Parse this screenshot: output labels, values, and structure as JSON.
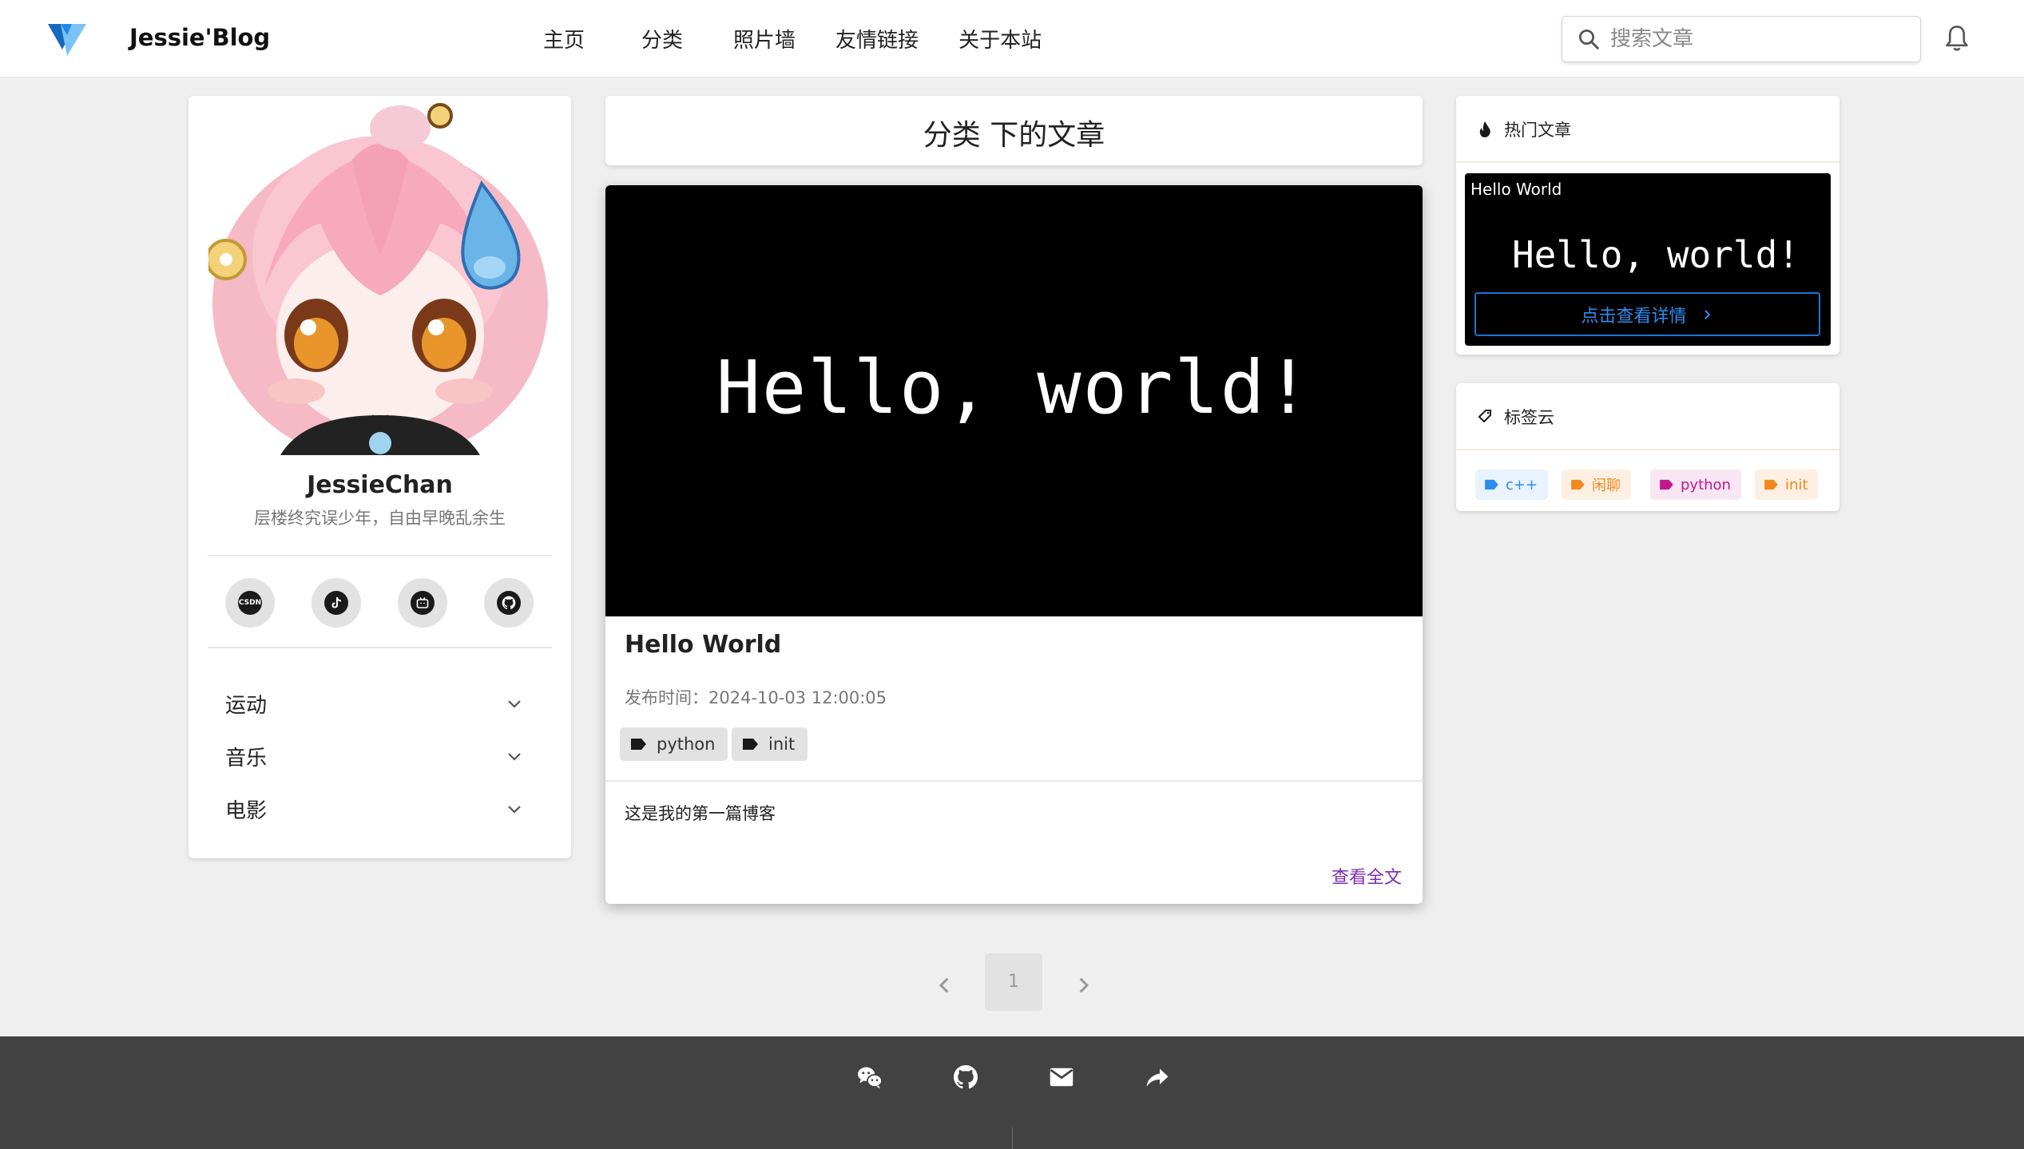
{
  "header": {
    "brand": "Jessie'Blog",
    "nav": [
      "主页",
      "分类",
      "照片墙",
      "友情链接",
      "关于本站"
    ],
    "search_placeholder": "搜索文章",
    "accent": "#2196f3"
  },
  "profile": {
    "name": "JessieChan",
    "motto": "层楼终究误少年，自由早晚乱余生",
    "social": [
      {
        "icon": "csdn-icon",
        "text": "CSDN"
      },
      {
        "icon": "tiktok-icon"
      },
      {
        "icon": "bilibili-icon"
      },
      {
        "icon": "github-icon"
      }
    ],
    "menu": [
      "运动",
      "音乐",
      "电影"
    ]
  },
  "main": {
    "page_title": "分类 下的文章",
    "posts": [
      {
        "cover_text": "Hello, world!",
        "title": "Hello World",
        "date": "发布时间：2024-10-03 12:00:05",
        "tags": [
          "python",
          "init"
        ],
        "excerpt": "这是我的第一篇博客",
        "read_more": "查看全文"
      }
    ],
    "pagination": {
      "current": "1"
    }
  },
  "sidebar": {
    "hot": {
      "title": "热门文章",
      "items": [
        {
          "title": "Hello World",
          "cover_text": "Hello, world!",
          "button": "点击查看详情"
        }
      ]
    },
    "tag_cloud": {
      "title": "标签云",
      "tags": [
        {
          "label": "c++",
          "color": "#2f8bf0",
          "bg": "#e8f3fd"
        },
        {
          "label": "闲聊",
          "color": "#f08a1c",
          "bg": "#fdf0e3"
        },
        {
          "label": "python",
          "color": "#c2188d",
          "bg": "#f8e6f2"
        },
        {
          "label": "init",
          "color": "#f08a1c",
          "bg": "#fdf0e3"
        }
      ]
    }
  },
  "footer": {
    "icons": [
      "wechat-icon",
      "github-icon",
      "email-icon",
      "share-icon"
    ],
    "bg": "#424242"
  }
}
